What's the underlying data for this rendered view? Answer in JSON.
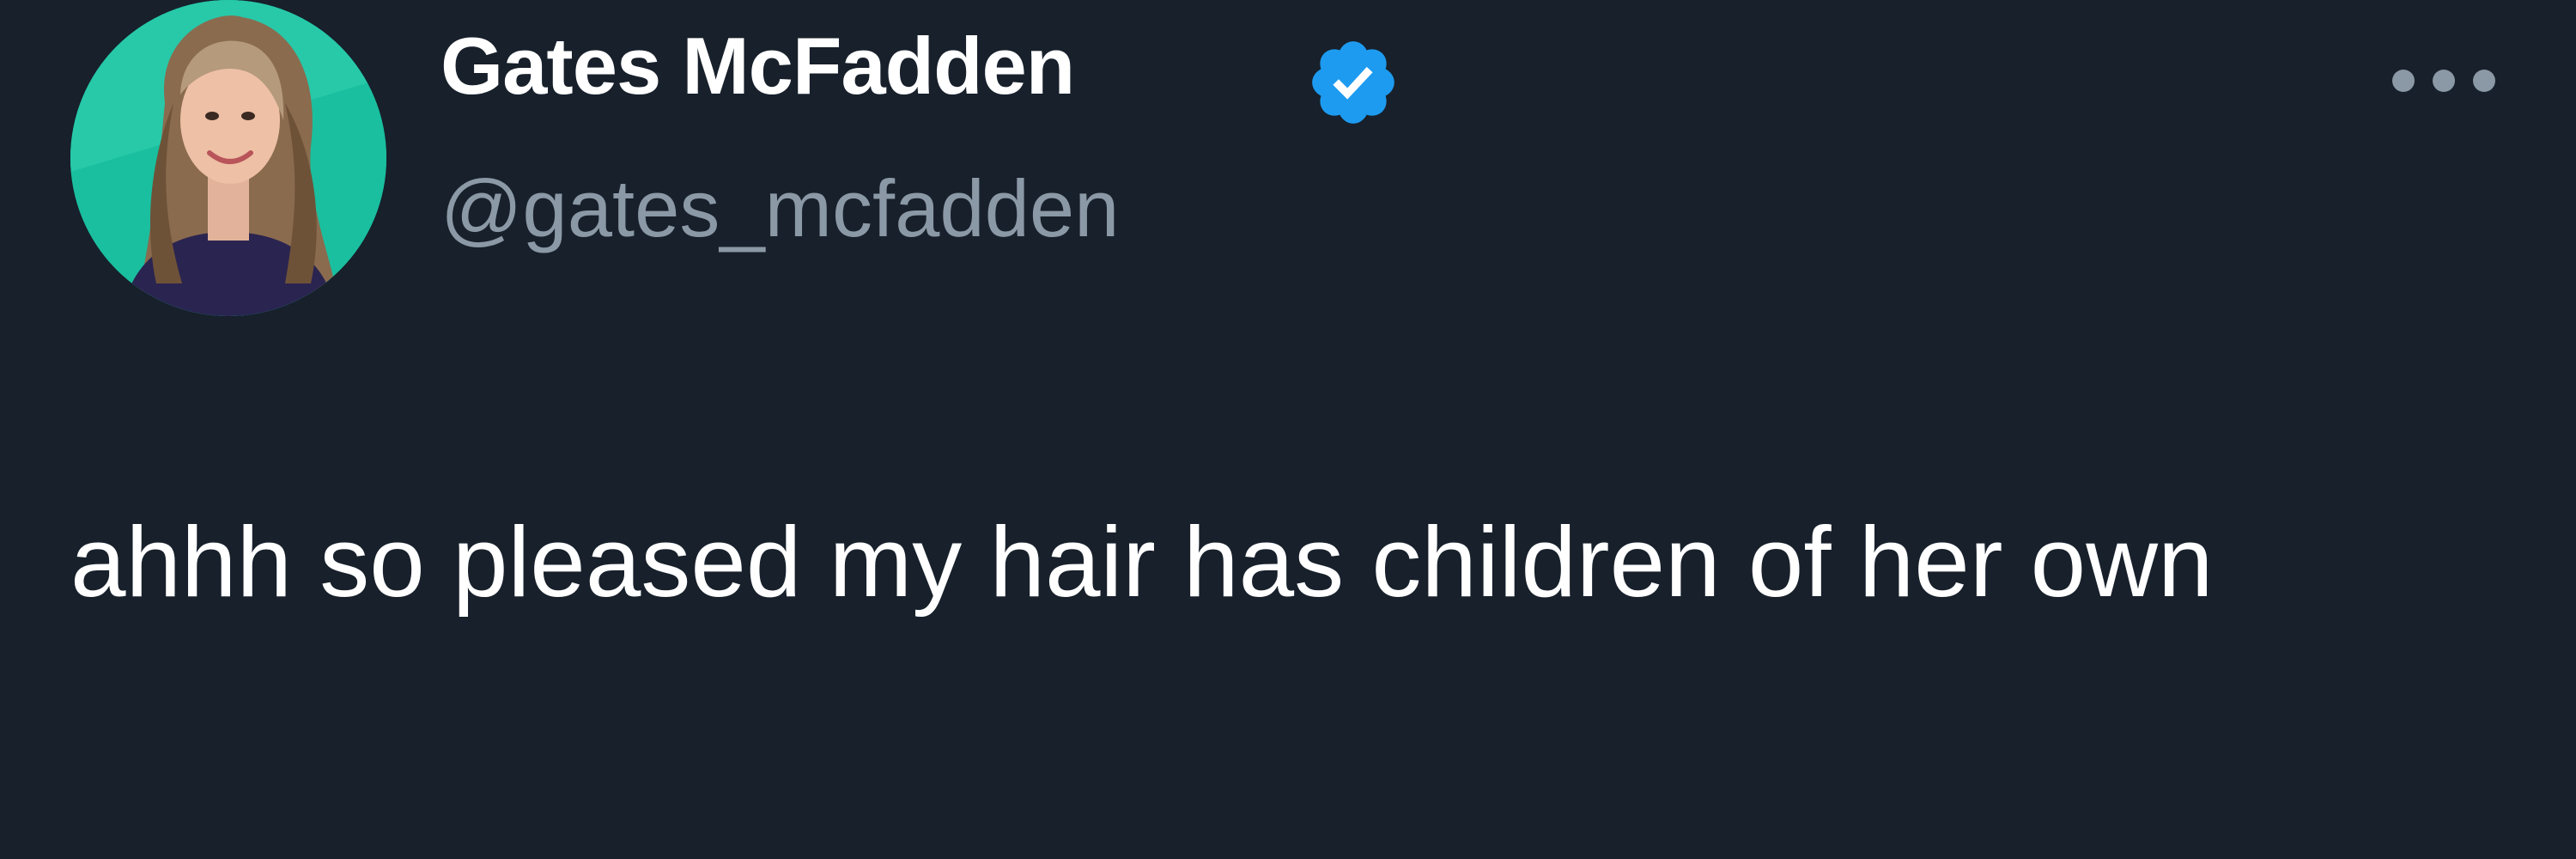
{
  "tweet": {
    "author": {
      "display_name": "Gates McFadden",
      "handle": "@gates_mcfadden",
      "verified": true,
      "avatar_icon": "profile-photo"
    },
    "text": "ahhh so pleased my hair has children of her own",
    "more_icon": "more-horizontal-icon"
  },
  "colors": {
    "background": "#17202b",
    "text": "#ffffff",
    "secondary": "#8b98a5",
    "verified_badge": "#1d9bf0",
    "avatar_background": "#1abf9f"
  }
}
